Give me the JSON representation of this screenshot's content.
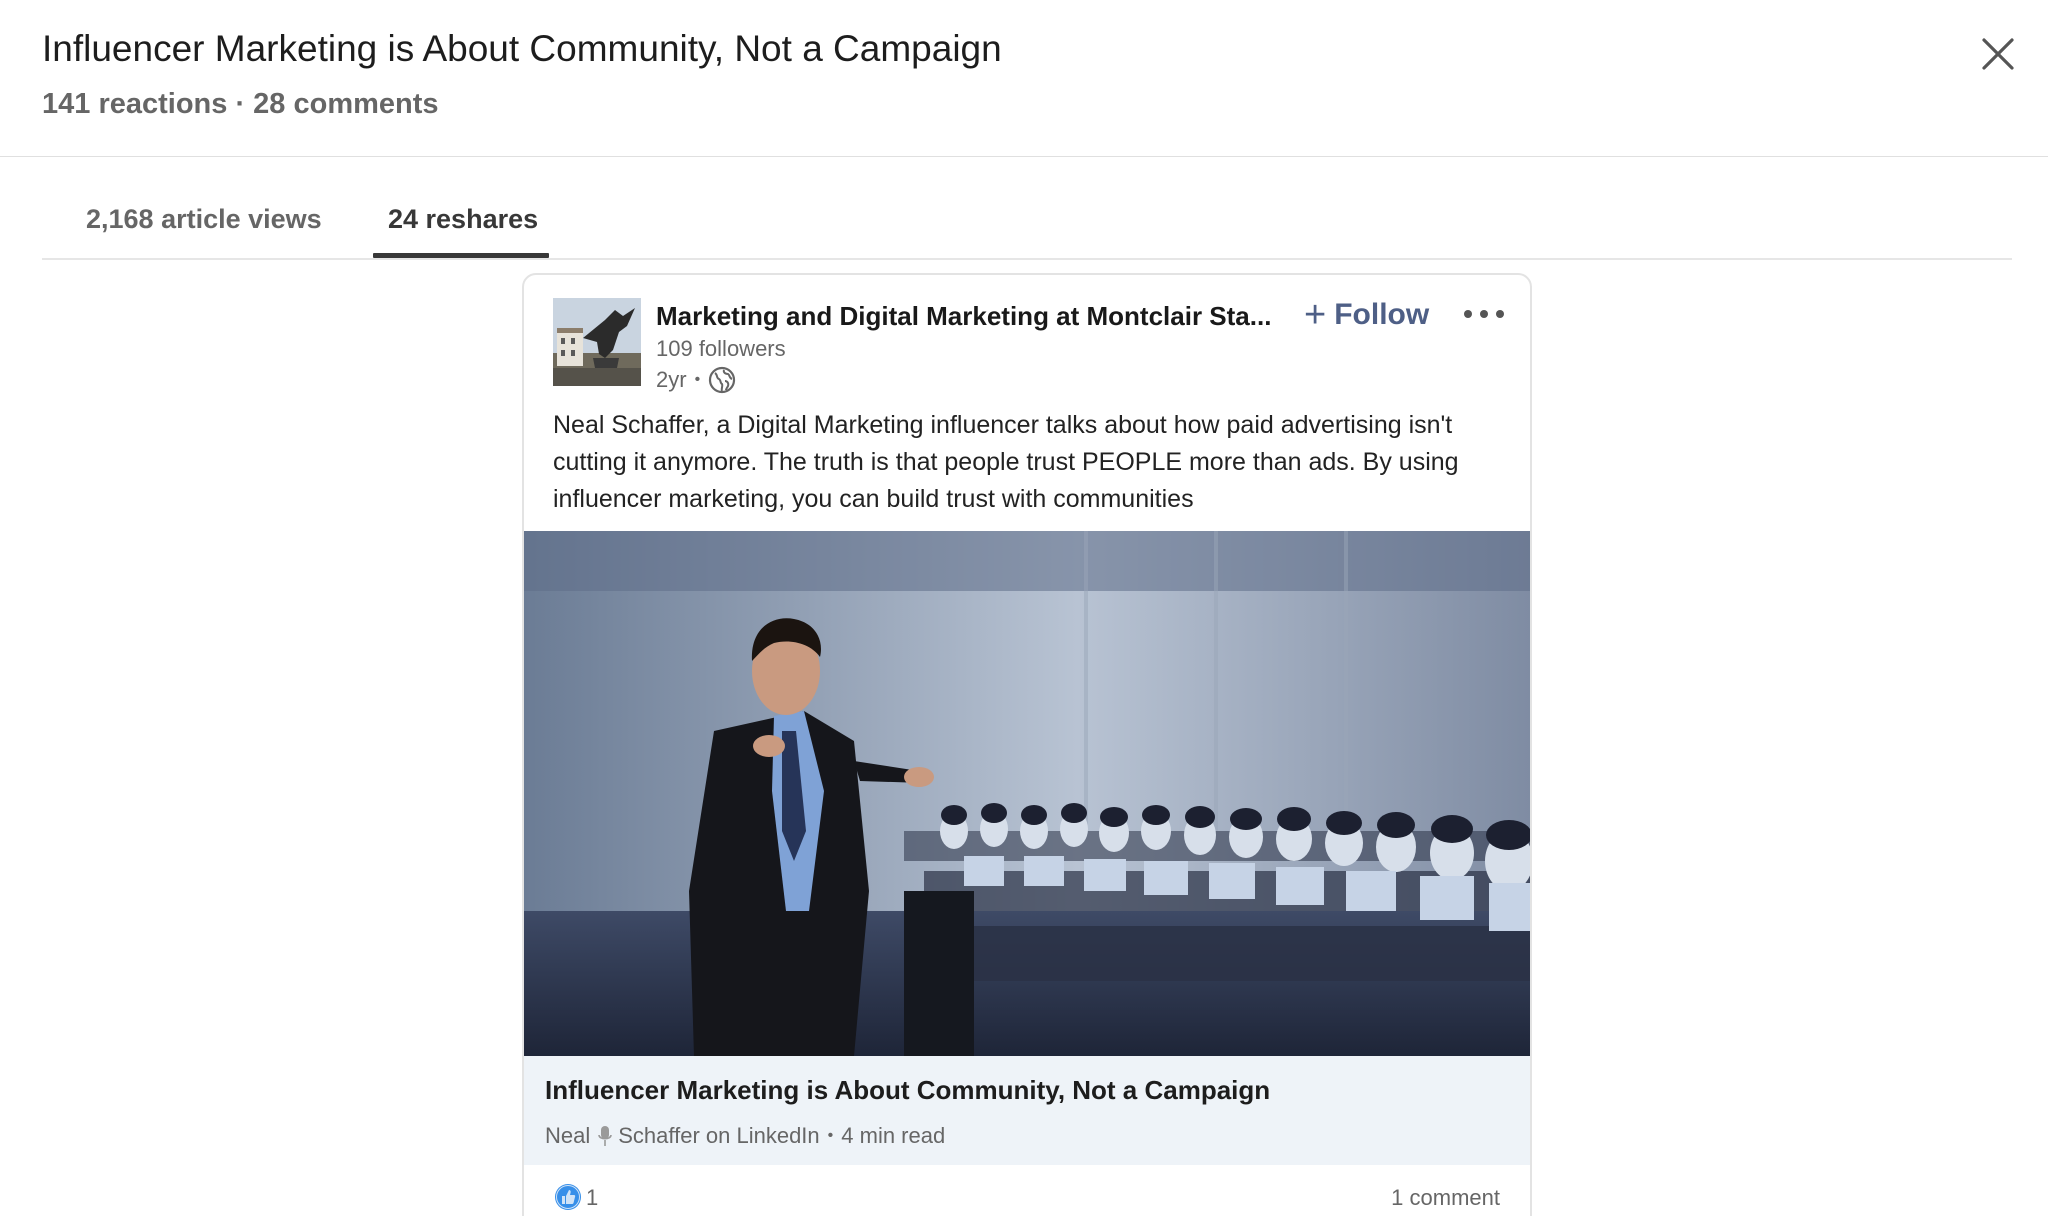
{
  "modal": {
    "title": "Influencer Marketing is About Community, Not a Campaign",
    "subtitle": "141 reactions · 28 comments",
    "close_icon": "close-icon"
  },
  "tabs": [
    {
      "label": "2,168 article views",
      "selected": false
    },
    {
      "label": "24 reshares",
      "selected": true
    }
  ],
  "post": {
    "author_name": "Marketing and Digital Marketing at Montclair Sta...",
    "followers": "109 followers",
    "timestamp": "2yr",
    "visibility_icon": "globe-icon",
    "follow_label": "Follow",
    "more_icon": "more-options-icon",
    "text": "Neal Schaffer, a Digital Marketing influencer talks about how paid advertising isn't cutting it anymore. The truth is that people trust PEOPLE more than ads. By using influencer marketing, you can build trust with communities",
    "article": {
      "title": "Influencer Marketing is About Community, Not a Campaign",
      "author_first": "Neal",
      "author_rest": "Schaffer on LinkedIn",
      "read_time": "4 min read"
    },
    "reactions_count": "1",
    "comments_label": "1 comment"
  },
  "colors": {
    "follow": "#4e5f86",
    "article_bg": "#eef3f8",
    "muted_text": "#666666"
  }
}
